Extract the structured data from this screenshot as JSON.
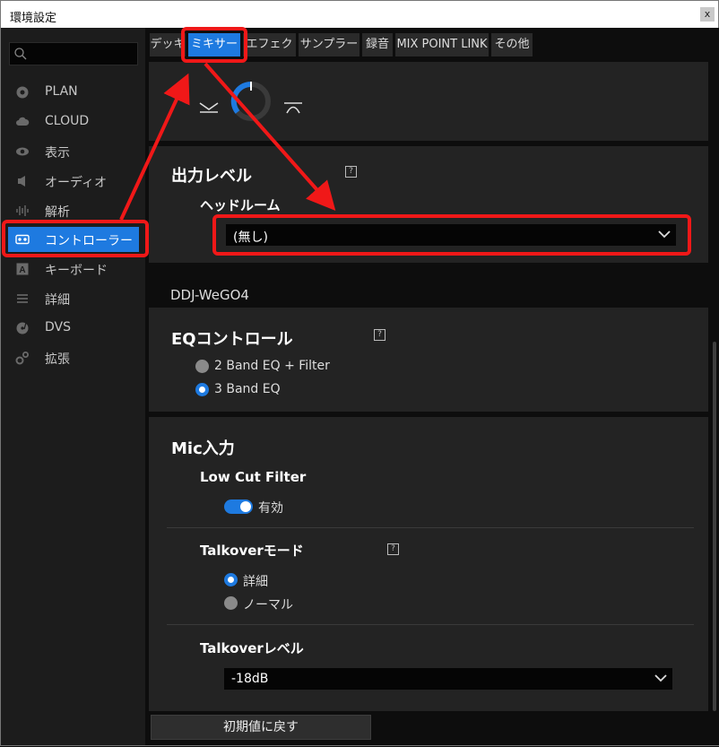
{
  "window": {
    "title": "環境設定",
    "close_glyph": "x"
  },
  "sidebar": {
    "items": [
      {
        "label": "PLAN",
        "icon": "plan-icon"
      },
      {
        "label": "CLOUD",
        "icon": "cloud-icon"
      },
      {
        "label": "表示",
        "icon": "eye-icon"
      },
      {
        "label": "オーディオ",
        "icon": "speaker-icon"
      },
      {
        "label": "解析",
        "icon": "waveform-icon"
      },
      {
        "label": "コントローラー",
        "icon": "controller-icon"
      },
      {
        "label": "キーボード",
        "icon": "keyboard-icon"
      },
      {
        "label": "詳細",
        "icon": "menu-lines-icon"
      },
      {
        "label": "DVS",
        "icon": "turntable-icon"
      },
      {
        "label": "拡張",
        "icon": "gears-icon"
      }
    ],
    "active": "コントローラー"
  },
  "tabs": [
    {
      "label": "デッキ"
    },
    {
      "label": "ミキサー"
    },
    {
      "label": "エフェクト"
    },
    {
      "label": "サンプラー"
    },
    {
      "label": "録音"
    },
    {
      "label": "MIX POINT LINK"
    },
    {
      "label": "その他"
    }
  ],
  "active_tab": "ミキサー",
  "content": {
    "crossfader": {
      "curve_icon_left": "cut-curve-icon",
      "curve_icon_right": "smooth-curve-icon"
    },
    "output_level": {
      "title": "出力レベル",
      "help": "?",
      "headroom_label": "ヘッドルーム",
      "headroom_value": "(無し)"
    },
    "device_name": "DDJ-WeGO4",
    "eq_control": {
      "title": "EQコントロール",
      "help": "?",
      "options": [
        "2 Band EQ + Filter",
        "3 Band EQ"
      ],
      "selected": "3 Band EQ"
    },
    "mic_input": {
      "title": "Mic入力",
      "low_cut_label": "Low Cut Filter",
      "low_cut_toggle_label": "有効",
      "low_cut_enabled": true,
      "talkover_mode_label": "Talkoverモード",
      "talkover_help": "?",
      "talkover_options": [
        "詳細",
        "ノーマル"
      ],
      "talkover_selected": "詳細",
      "talkover_level_label": "Talkoverレベル",
      "talkover_level_value": "-18dB"
    }
  },
  "footer": {
    "reset_label": "初期値に戻す"
  },
  "colors": {
    "accent": "#1e7ae0",
    "annotation": "#f01818",
    "panel": "#232323"
  }
}
